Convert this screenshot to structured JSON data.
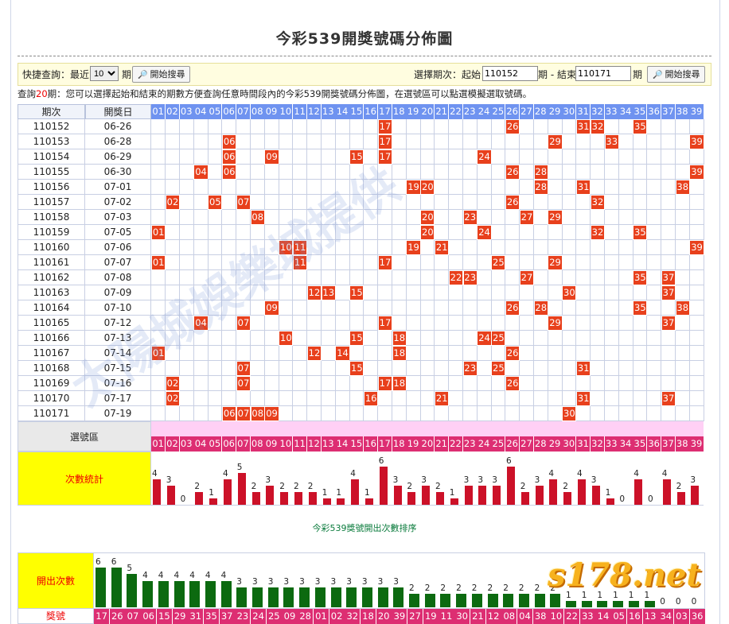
{
  "page": {
    "title": "今彩539開獎號碼分佈圖",
    "watermark": "太陽城娛樂城提供",
    "logo_text": "s178.net"
  },
  "query_bar": {
    "quick_label": "快捷查詢：最近",
    "recent_value": "10",
    "recent_unit": "期",
    "search_button": "開始搜尋",
    "range_label": "選擇期次：起始",
    "start_value": "110152",
    "mid_label": "期 - 結束",
    "end_value": "110171",
    "end_unit": "期",
    "range_button": "開始搜尋"
  },
  "notice": {
    "prefix": "查詢",
    "count": "20",
    "suffix": "期：您可以選擇起始和結束的期數方便查詢任意時間段內的今彩539開獎號碼分佈圖，在選號區可以點選模擬選取號碼。"
  },
  "table": {
    "col_period": "期次",
    "col_date": "開獎日",
    "numbers": [
      "01",
      "02",
      "03",
      "04",
      "05",
      "06",
      "07",
      "08",
      "09",
      "10",
      "11",
      "12",
      "13",
      "14",
      "15",
      "16",
      "17",
      "18",
      "19",
      "20",
      "21",
      "22",
      "23",
      "24",
      "25",
      "26",
      "27",
      "28",
      "29",
      "30",
      "31",
      "32",
      "33",
      "34",
      "35",
      "36",
      "37",
      "38",
      "39"
    ],
    "draws": [
      {
        "period": "110152",
        "date": "06-26",
        "nums": [
          "17",
          "26",
          "31",
          "32",
          "35"
        ]
      },
      {
        "period": "110153",
        "date": "06-28",
        "nums": [
          "06",
          "17",
          "29",
          "33",
          "39"
        ]
      },
      {
        "period": "110154",
        "date": "06-29",
        "nums": [
          "06",
          "09",
          "15",
          "17",
          "24"
        ]
      },
      {
        "period": "110155",
        "date": "06-30",
        "nums": [
          "04",
          "06",
          "26",
          "28",
          "39"
        ]
      },
      {
        "period": "110156",
        "date": "07-01",
        "nums": [
          "19",
          "20",
          "28",
          "31",
          "38"
        ]
      },
      {
        "period": "110157",
        "date": "07-02",
        "nums": [
          "02",
          "05",
          "07",
          "26",
          "32"
        ]
      },
      {
        "period": "110158",
        "date": "07-03",
        "nums": [
          "08",
          "20",
          "23",
          "27",
          "29"
        ]
      },
      {
        "period": "110159",
        "date": "07-05",
        "nums": [
          "01",
          "20",
          "24",
          "32",
          "35"
        ]
      },
      {
        "period": "110160",
        "date": "07-06",
        "nums": [
          "10",
          "11",
          "19",
          "21",
          "39"
        ]
      },
      {
        "period": "110161",
        "date": "07-07",
        "nums": [
          "01",
          "11",
          "17",
          "25",
          "29"
        ]
      },
      {
        "period": "110162",
        "date": "07-08",
        "nums": [
          "22",
          "23",
          "27",
          "35",
          "37"
        ]
      },
      {
        "period": "110163",
        "date": "07-09",
        "nums": [
          "12",
          "13",
          "15",
          "30",
          "37"
        ]
      },
      {
        "period": "110164",
        "date": "07-10",
        "nums": [
          "09",
          "26",
          "28",
          "35",
          "38"
        ]
      },
      {
        "period": "110165",
        "date": "07-12",
        "nums": [
          "04",
          "07",
          "17",
          "29",
          "37"
        ]
      },
      {
        "period": "110166",
        "date": "07-13",
        "nums": [
          "10",
          "15",
          "18",
          "24",
          "25"
        ]
      },
      {
        "period": "110167",
        "date": "07-14",
        "nums": [
          "01",
          "12",
          "14",
          "18",
          "26"
        ]
      },
      {
        "period": "110168",
        "date": "07-15",
        "nums": [
          "07",
          "15",
          "23",
          "25",
          "31"
        ]
      },
      {
        "period": "110169",
        "date": "07-16",
        "nums": [
          "02",
          "07",
          "17",
          "18",
          "26"
        ]
      },
      {
        "period": "110170",
        "date": "07-17",
        "nums": [
          "02",
          "16",
          "21",
          "31",
          "37"
        ]
      },
      {
        "period": "110171",
        "date": "07-19",
        "nums": [
          "06",
          "07",
          "08",
          "09",
          "30"
        ]
      }
    ],
    "select_label": "選號區",
    "stats_label": "次數統計",
    "counts": [
      4,
      3,
      0,
      2,
      1,
      4,
      5,
      2,
      3,
      2,
      2,
      2,
      1,
      1,
      4,
      1,
      6,
      3,
      2,
      3,
      2,
      1,
      3,
      3,
      3,
      6,
      2,
      3,
      4,
      2,
      4,
      3,
      1,
      0,
      4,
      0,
      4,
      2,
      3
    ]
  },
  "ranking": {
    "title": "今彩539獎號開出次數排序",
    "count_label": "開出次數",
    "number_label": "獎號",
    "numbers": [
      "17",
      "26",
      "07",
      "06",
      "15",
      "29",
      "31",
      "35",
      "37",
      "23",
      "24",
      "25",
      "09",
      "28",
      "01",
      "02",
      "32",
      "18",
      "20",
      "39",
      "27",
      "19",
      "11",
      "30",
      "21",
      "12",
      "08",
      "04",
      "38",
      "10",
      "22",
      "33",
      "14",
      "05",
      "16",
      "13",
      "34",
      "03",
      "36"
    ],
    "counts": [
      6,
      6,
      5,
      4,
      4,
      4,
      4,
      4,
      4,
      3,
      3,
      3,
      3,
      3,
      3,
      3,
      3,
      3,
      3,
      3,
      2,
      2,
      2,
      2,
      2,
      2,
      2,
      2,
      2,
      2,
      1,
      1,
      1,
      1,
      1,
      1,
      0,
      0,
      0
    ]
  },
  "colors": {
    "header_blue": "#6f93f0",
    "hit_red": "#e8401c",
    "stat_bar": "#cc1128",
    "rank_bar": "#0c6a10",
    "select_pink": "#ffd0f5",
    "number_pink": "#dd2e72",
    "label_yellow": "#ffff00"
  }
}
